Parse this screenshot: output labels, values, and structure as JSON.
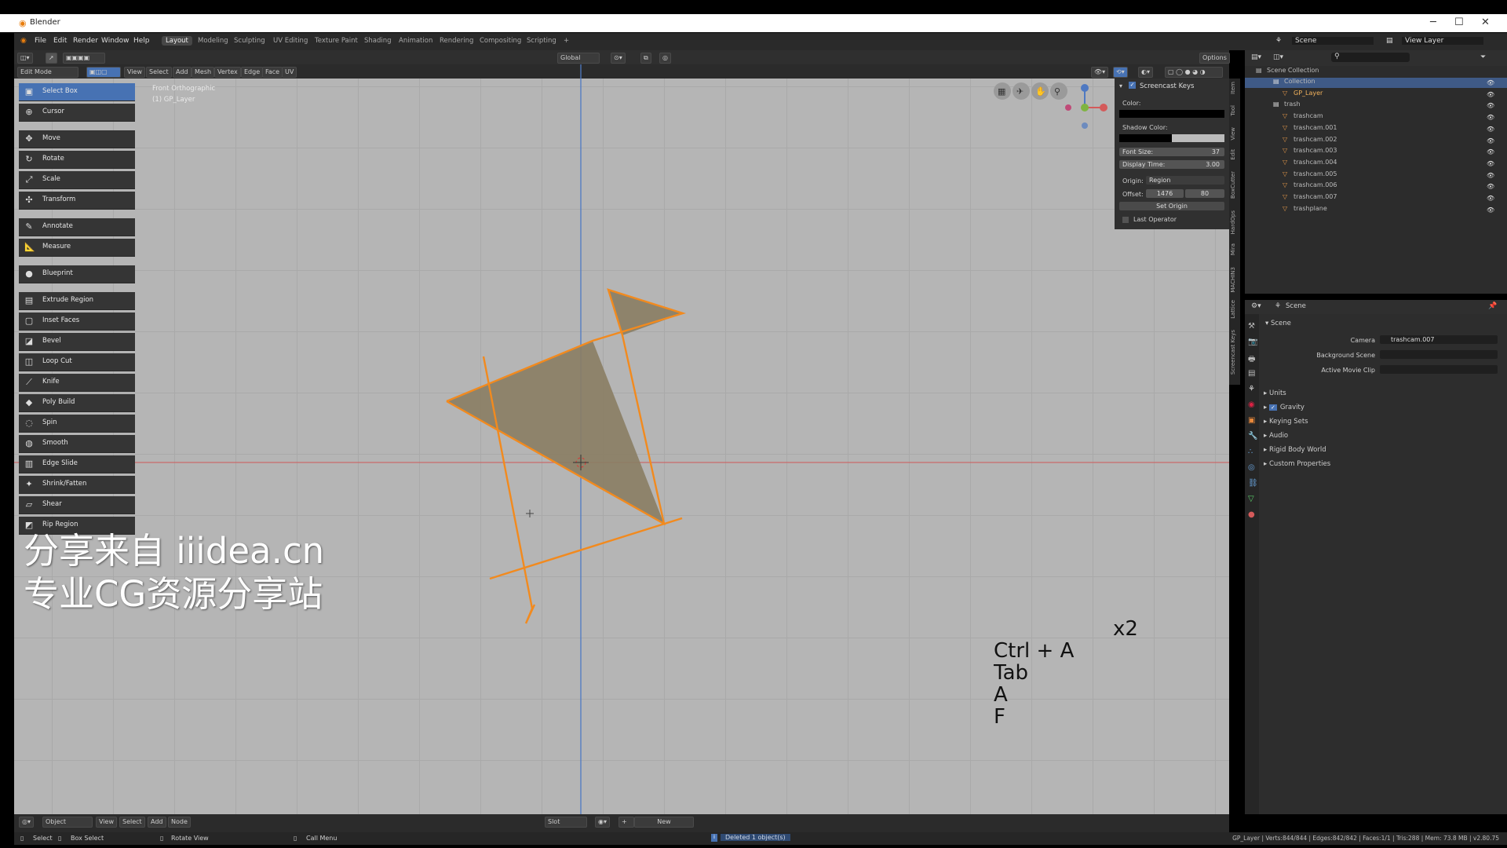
{
  "window": {
    "title": "Blender",
    "minimize": "─",
    "maximize": "☐",
    "close": "✕"
  },
  "menu": [
    "File",
    "Edit",
    "Render",
    "Window",
    "Help"
  ],
  "workspaces": [
    "Layout",
    "Modeling",
    "Sculpting",
    "UV Editing",
    "Texture Paint",
    "Shading",
    "Animation",
    "Rendering",
    "Compositing",
    "Scripting",
    "+"
  ],
  "topbar_right": {
    "scene": "Scene",
    "view_layer": "View Layer"
  },
  "viewport_header": {
    "mode": "Edit Mode",
    "menus": [
      "View",
      "Select",
      "Add",
      "Mesh",
      "Vertex",
      "Edge",
      "Face",
      "UV"
    ],
    "orientation": "Global",
    "options": "Options"
  },
  "viewport": {
    "view_name": "Front Orthographic",
    "layer_name": "(1) GP_Layer"
  },
  "tools": [
    {
      "label": "Select Box",
      "icon": "▣",
      "active": true
    },
    {
      "label": "Cursor",
      "icon": "⊕"
    },
    {
      "label": "Move",
      "icon": "✥"
    },
    {
      "label": "Rotate",
      "icon": "↻"
    },
    {
      "label": "Scale",
      "icon": "⤢"
    },
    {
      "label": "Transform",
      "icon": "✣"
    },
    {
      "label": "Annotate",
      "icon": "✎"
    },
    {
      "label": "Measure",
      "icon": "📐"
    },
    {
      "label": "Blueprint",
      "icon": "●"
    },
    {
      "label": "Extrude Region",
      "icon": "▤"
    },
    {
      "label": "Inset Faces",
      "icon": "▢"
    },
    {
      "label": "Bevel",
      "icon": "◪"
    },
    {
      "label": "Loop Cut",
      "icon": "◫"
    },
    {
      "label": "Knife",
      "icon": "⟋"
    },
    {
      "label": "Poly Build",
      "icon": "◆"
    },
    {
      "label": "Spin",
      "icon": "◌"
    },
    {
      "label": "Smooth",
      "icon": "◍"
    },
    {
      "label": "Edge Slide",
      "icon": "▥"
    },
    {
      "label": "Shrink/Fatten",
      "icon": "✦"
    },
    {
      "label": "Shear",
      "icon": "▱"
    },
    {
      "label": "Rip Region",
      "icon": "◩"
    }
  ],
  "watermark": {
    "line1": "分享来自 iiidea.cn",
    "line2": "专业CG资源分享站"
  },
  "keys_overlay": {
    "count": "x2",
    "lines": [
      "Ctrl + A",
      "Tab",
      "A",
      "F"
    ]
  },
  "screencast_panel": {
    "title": "Screencast Keys",
    "color_label": "Color:",
    "shadow_label": "Shadow Color:",
    "font_size_label": "Font Size:",
    "font_size": "37",
    "display_time_label": "Display Time:",
    "display_time": "3.00",
    "origin_label": "Origin:",
    "origin": "Region",
    "offset_label": "Offset:",
    "offset_x": "1476",
    "offset_y": "80",
    "set_origin": "Set Origin",
    "last_operator": "Last Operator"
  },
  "side_tabs": [
    "Item",
    "Tool",
    "View",
    "Edit",
    "BoxCutter",
    "HardOps",
    "Mira",
    "MACHIN3",
    "Lattice",
    "Screencast Keys"
  ],
  "outliner": {
    "root": "Scene Collection",
    "rows": [
      {
        "label": "Collection",
        "indent": 1,
        "selected": true
      },
      {
        "label": "GP_Layer",
        "indent": 2,
        "highlight": true
      },
      {
        "label": "trash",
        "indent": 1
      },
      {
        "label": "trashcam",
        "indent": 2
      },
      {
        "label": "trashcam.001",
        "indent": 2
      },
      {
        "label": "trashcam.002",
        "indent": 2
      },
      {
        "label": "trashcam.003",
        "indent": 2
      },
      {
        "label": "trashcam.004",
        "indent": 2
      },
      {
        "label": "trashcam.005",
        "indent": 2
      },
      {
        "label": "trashcam.006",
        "indent": 2
      },
      {
        "label": "trashcam.007",
        "indent": 2
      },
      {
        "label": "trashplane",
        "indent": 2
      }
    ]
  },
  "properties": {
    "header": "Scene",
    "section": "Scene",
    "camera_label": "Camera",
    "camera": "trashcam.007",
    "bg_scene_label": "Background Scene",
    "movie_clip_label": "Active Movie Clip",
    "panels": [
      "Units",
      "Gravity",
      "Keying Sets",
      "Audio",
      "Rigid Body World",
      "Custom Properties"
    ]
  },
  "bottom_header": {
    "editor": "Object",
    "menus": [
      "View",
      "Select",
      "Add",
      "Node"
    ],
    "slot": "Slot",
    "new": "New"
  },
  "statusbar": {
    "select": "Select",
    "box_select": "Box Select",
    "rotate_view": "Rotate View",
    "call_menu": "Call Menu",
    "message": "Deleted 1 object(s)",
    "stats": "GP_Layer | Verts:844/844 | Edges:842/842 | Faces:1/1 | Tris:288 | Mem: 73.8 MB | v2.80.75"
  },
  "colors": {
    "selection_orange": "#f28a1e",
    "face_fill": "#8a7d63",
    "active_blue": "#4772b3"
  }
}
